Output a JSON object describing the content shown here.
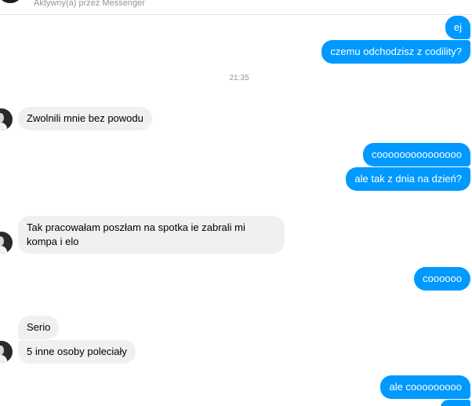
{
  "header": {
    "status_text": "Aktywny(a) przez Messenger"
  },
  "messages": [
    {
      "id": "m1",
      "direction": "out",
      "text": "ej"
    },
    {
      "id": "m2",
      "direction": "out",
      "text": "czemu odchodzisz z codility?"
    },
    {
      "id": "t1",
      "type": "timestamp",
      "text": "21:35"
    },
    {
      "id": "m3",
      "direction": "in",
      "text": "Zwolnili mnie bez powodu"
    },
    {
      "id": "m4",
      "direction": "out",
      "text": "cooooooooooooooo"
    },
    {
      "id": "m5",
      "direction": "out",
      "text": "ale tak z dnia na dzień?"
    },
    {
      "id": "m6",
      "direction": "in",
      "text": "Tak pracowałam poszłam na spotka ie zabrali mi kompa i elo"
    },
    {
      "id": "m7",
      "direction": "out",
      "text": "coooooo"
    },
    {
      "id": "m8",
      "direction": "in",
      "text": "Serio"
    },
    {
      "id": "m9",
      "direction": "in",
      "text": "5 inne osoby poleciały"
    },
    {
      "id": "m10",
      "direction": "out",
      "text": "ale cooooooooo"
    }
  ],
  "colors": {
    "outgoing_bubble": "#0099ff",
    "incoming_bubble": "#f1f0f0",
    "meta_text": "#90949c"
  }
}
